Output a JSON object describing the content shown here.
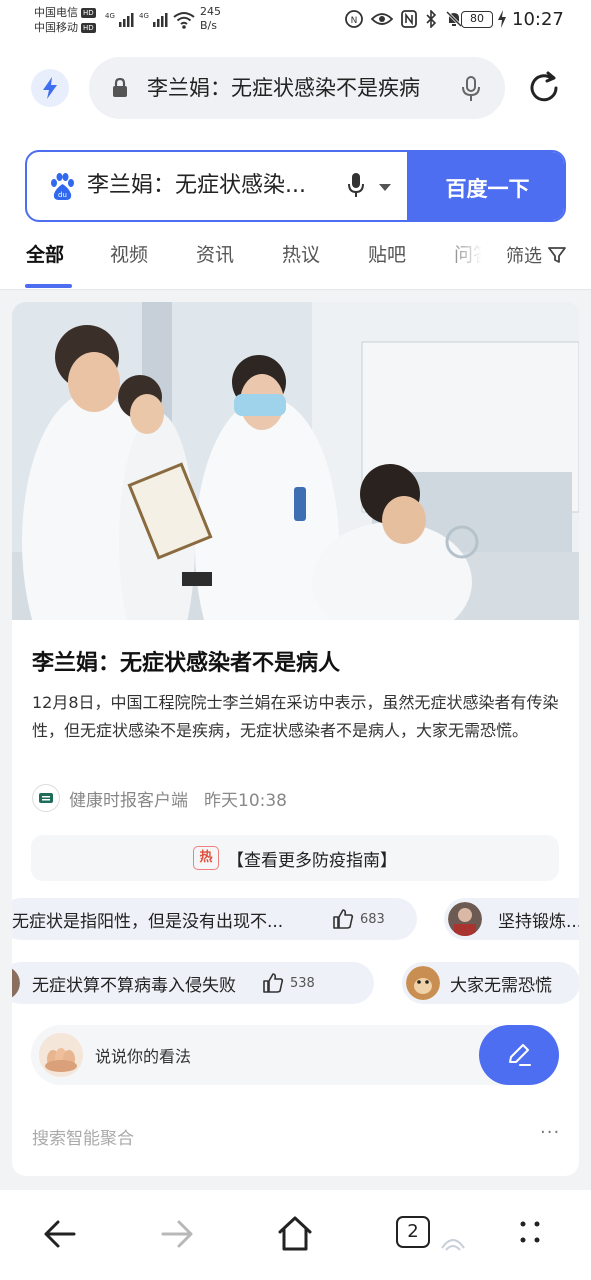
{
  "status_bar": {
    "carrier1": "中国电信",
    "carrier2": "中国移动",
    "hd_badge": "HD",
    "signal_label": "4G",
    "net_speed_value": "245",
    "net_speed_unit": "B/s",
    "battery": "80",
    "time": "10:27",
    "icons": [
      "nfc-icon",
      "eye-icon",
      "n-icon",
      "bluetooth-icon",
      "mute-bell-icon",
      "charging-icon"
    ]
  },
  "browser": {
    "url_text": "李兰娟：无症状感染不是疾病",
    "icons": [
      "bolt-icon",
      "lock-icon",
      "mic-icon",
      "refresh-icon"
    ]
  },
  "search": {
    "query": "李兰娟：无症状感染...",
    "button_label": "百度一下",
    "tabs": [
      "全部",
      "视频",
      "资讯",
      "热议",
      "贴吧",
      "问答"
    ],
    "filter_label": "筛选"
  },
  "card": {
    "title": "李兰娟：无症状感染者不是病人",
    "summary": "12月8日，中国工程院院士李兰娟在采访中表示，虽然无症状感染者有传染性，但无症状感染不是疾病，无症状感染者不是病人，大家无需恐慌。",
    "source": "健康时报客户端",
    "time": "昨天10:38",
    "hot_badge": "热",
    "guide_link": "【查看更多防疫指南】",
    "comments_row1": [
      {
        "text": "无症状是指阳性，但是没有出现不...",
        "likes": "683"
      },
      {
        "text": "坚持锻炼..."
      }
    ],
    "comments_row2": [
      {
        "text": "无症状算不算病毒入侵失败",
        "likes": "538"
      },
      {
        "text": "大家无需恐慌"
      }
    ],
    "comment_placeholder": "说说你的看法",
    "aggregation_label": "搜索智能聚合",
    "more_label": "···"
  },
  "bottom_nav": {
    "tab_count": "2",
    "watermark": "noodles"
  },
  "colors": {
    "accent": "#4e6ef2",
    "chip_bg": "#eef1f8",
    "hot": "#e0503c"
  }
}
